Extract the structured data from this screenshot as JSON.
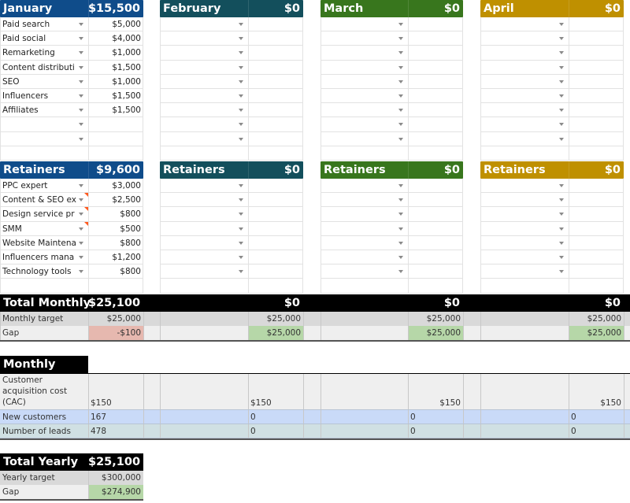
{
  "colors": {
    "january": "#0f4c8a",
    "february": "#134f5c",
    "march": "#38761d",
    "april": "#bf9000",
    "total_bar": "#000000",
    "target_row": "#d9d9d9",
    "gap_row": "#efefef",
    "gap_negative": "#e6b8af",
    "gap_positive": "#b6d7a8",
    "kpi_cac_row": "#efefef",
    "kpi_customers_row": "#c9daf8",
    "kpi_leads_row": "#d0e0e3"
  },
  "months": [
    {
      "name": "January",
      "total": "$15,500",
      "items": [
        {
          "label": "Paid search",
          "value": "$5,000"
        },
        {
          "label": "Paid social",
          "value": "$4,000"
        },
        {
          "label": "Remarketing",
          "value": "$1,000"
        },
        {
          "label": "Content distributi",
          "value": "$1,500"
        },
        {
          "label": "SEO",
          "value": "$1,000"
        },
        {
          "label": "Influencers",
          "value": "$1,500"
        },
        {
          "label": "Affiliates",
          "value": "$1,500"
        },
        {
          "label": "",
          "value": ""
        },
        {
          "label": "",
          "value": ""
        }
      ],
      "retainers_label": "Retainers",
      "retainers_total": "$9,600",
      "retainers": [
        {
          "label": "PPC expert",
          "value": "$3,000",
          "note": false
        },
        {
          "label": "Content & SEO ex",
          "value": "$2,500",
          "note": true
        },
        {
          "label": "Design service pr",
          "value": "$800",
          "note": true
        },
        {
          "label": "SMM",
          "value": "$500",
          "note": true
        },
        {
          "label": "Website Maintena",
          "value": "$800",
          "note": false
        },
        {
          "label": "Influencers mana",
          "value": "$1,200",
          "note": false
        },
        {
          "label": "Technology tools",
          "value": "$800",
          "note": false
        }
      ]
    },
    {
      "name": "February",
      "total": "$0",
      "retainers_label": "Retainers",
      "retainers_total": "$0"
    },
    {
      "name": "March",
      "total": "$0",
      "retainers_label": "Retainers",
      "retainers_total": "$0"
    },
    {
      "name": "April",
      "total": "$0",
      "retainers_label": "Retainers",
      "retainers_total": "$0"
    }
  ],
  "total_monthly": {
    "label": "Total Monthly",
    "values": [
      "$25,100",
      "$0",
      "$0",
      "$0"
    ],
    "target_label": "Monthly target",
    "targets": [
      "$25,000",
      "$25,000",
      "$25,000",
      "$25,000"
    ],
    "gap_label": "Gap",
    "gaps": [
      "-$100",
      "$25,000",
      "$25,000",
      "$25,000"
    ]
  },
  "kpis": {
    "title": "Monthly KPIs",
    "rows": [
      {
        "label": "Customer acquisition cost (CAC)",
        "label_lines": [
          "Customer",
          "acquisition cost",
          "(CAC)"
        ],
        "values": [
          "$150",
          "$150",
          "$150",
          "$150"
        ]
      },
      {
        "label": "New customers",
        "values": [
          "167",
          "0",
          "0",
          "0"
        ]
      },
      {
        "label": "Number of leads",
        "values": [
          "478",
          "0",
          "0",
          "0"
        ]
      }
    ]
  },
  "total_yearly": {
    "label": "Total Yearly",
    "value": "$25,100",
    "target_label": "Yearly target",
    "target": "$300,000",
    "gap_label": "Gap",
    "gap": "$274,900"
  }
}
